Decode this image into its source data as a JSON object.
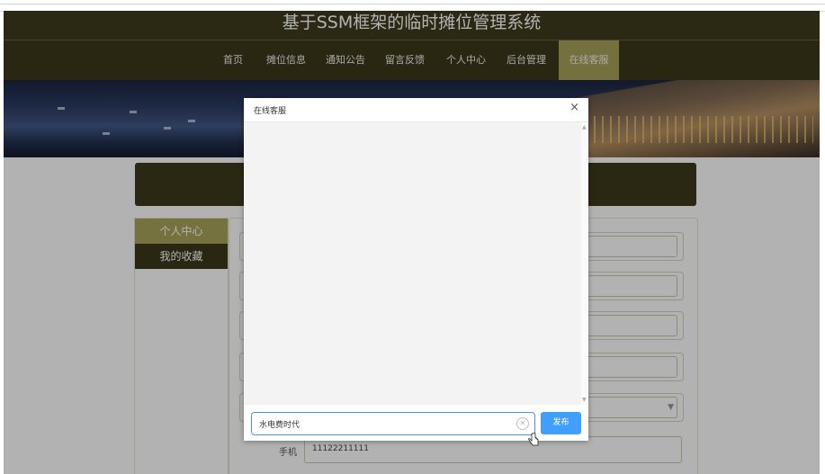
{
  "site": {
    "title": "基于SSM框架的临时摊位管理系统"
  },
  "nav": {
    "items": [
      {
        "label": "首页"
      },
      {
        "label": "摊位信息"
      },
      {
        "label": "通知公告"
      },
      {
        "label": "留言反馈"
      },
      {
        "label": "个人中心"
      },
      {
        "label": "后台管理"
      },
      {
        "label": "在线客服",
        "active": true
      }
    ]
  },
  "sidebar": {
    "items": [
      {
        "label": "个人中心"
      },
      {
        "label": "我的收藏"
      }
    ]
  },
  "form": {
    "phone_label": "手机",
    "phone_value": "11122211111"
  },
  "dialog": {
    "title": "在线客服",
    "close": "×",
    "input_value": "水电费时代",
    "send_label": "发布"
  },
  "colors": {
    "dark_olive": "#3b3719",
    "olive_accent": "#a8a35a",
    "send_blue": "#409eff"
  }
}
